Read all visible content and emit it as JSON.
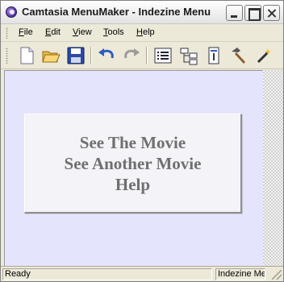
{
  "window": {
    "title": "Camtasia MenuMaker - Indezine Menu"
  },
  "menubar": {
    "items": [
      {
        "label": "File",
        "accel": "F",
        "rest": "ile"
      },
      {
        "label": "Edit",
        "accel": "E",
        "rest": "dit"
      },
      {
        "label": "View",
        "accel": "V",
        "rest": "iew"
      },
      {
        "label": "Tools",
        "accel": "T",
        "rest": "ools"
      },
      {
        "label": "Help",
        "accel": "H",
        "rest": "elp"
      }
    ]
  },
  "toolbar": {
    "icons": [
      "new-document-icon",
      "open-folder-icon",
      "save-disk-icon",
      "undo-icon",
      "redo-icon",
      "menu-list-icon",
      "tree-structure-icon",
      "properties-icon",
      "hammer-build-icon",
      "magic-wand-icon"
    ]
  },
  "menu_panel": {
    "items": [
      "See The Movie",
      "See Another Movie",
      "Help"
    ]
  },
  "status": {
    "left": "Ready",
    "right": "Indezine Me"
  },
  "colors": {
    "client_background": "#e4e4fc",
    "panel_text": "#6f6f6f",
    "window_chrome": "#ece9d8"
  }
}
